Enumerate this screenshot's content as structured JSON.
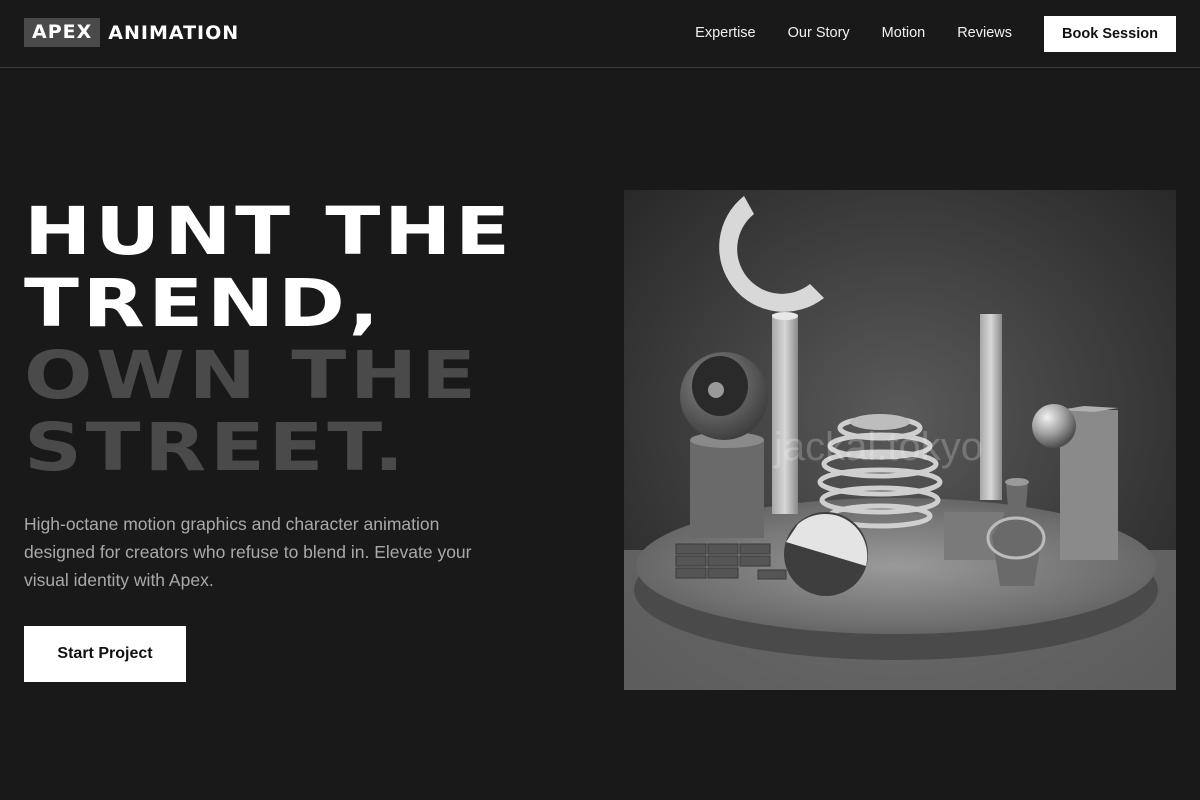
{
  "brand": {
    "logo_box": "APEX",
    "logo_rest": "ANIMATION"
  },
  "nav": {
    "links": [
      "Expertise",
      "Our Story",
      "Motion",
      "Reviews"
    ],
    "cta": "Book Session"
  },
  "hero": {
    "title_line1": "HUNT THE",
    "title_line2": "TREND,",
    "title_line3": "OWN THE",
    "title_line4": "STREET.",
    "description": "High-octane motion graphics and character animation designed for creators who refuse to blend in. Elevate your visual identity with Apex.",
    "cta": "Start Project"
  },
  "media": {
    "watermark": "jackal.tokyo"
  },
  "colors": {
    "background": "#191919",
    "accent_dim": "#4a4a4a",
    "button": "#ffffff"
  }
}
